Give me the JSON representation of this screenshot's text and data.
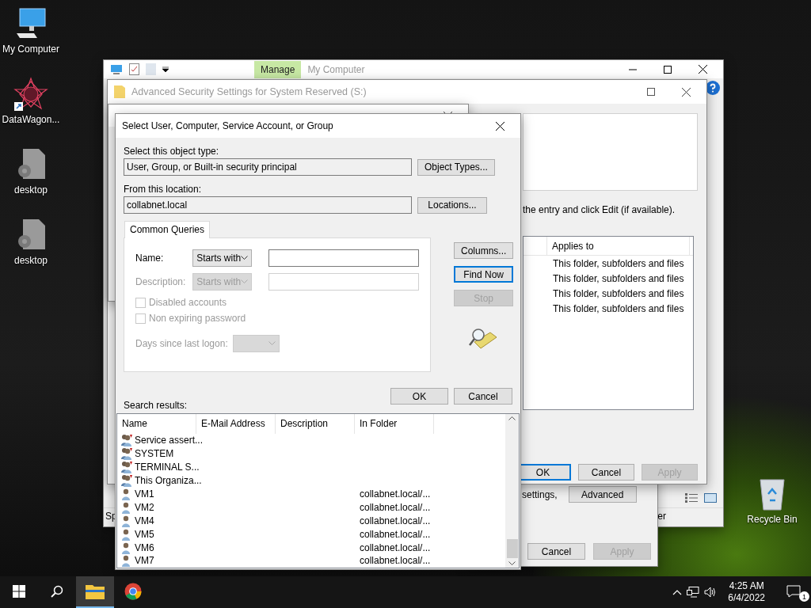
{
  "desktop_icons": [
    {
      "label": "My Computer",
      "kind": "computer"
    },
    {
      "label": "DataWagon...",
      "kind": "app"
    },
    {
      "label": "desktop",
      "kind": "file"
    },
    {
      "label": "desktop",
      "kind": "file"
    }
  ],
  "desktop_icons_right": [
    {
      "label": "Recycle Bin",
      "kind": "recycle"
    }
  ],
  "explorer_window": {
    "ribbon_tab": "Manage",
    "title": "My Computer",
    "status_left": "Sp",
    "status_right": "er"
  },
  "properties_window": {
    "text": "settings,",
    "advanced_button": "Advanced",
    "buttons": [
      {
        "label": "Cancel",
        "disabled": false
      },
      {
        "label": "Apply",
        "disabled": true
      }
    ]
  },
  "advanced_security_window": {
    "title": "Advanced Security Settings for System Reserved (S:)",
    "instruction": "the entry and click Edit (if available).",
    "table": {
      "columns": [
        "Applies to"
      ],
      "rows": [
        "This folder, subfolders and files",
        "This folder, subfolders and files",
        "This folder, subfolders and files",
        "This folder, subfolders and files"
      ]
    },
    "buttons": [
      {
        "label": "OK",
        "disabled": false,
        "default": true
      },
      {
        "label": "Cancel",
        "disabled": false,
        "default": false
      },
      {
        "label": "Apply",
        "disabled": true,
        "default": false
      }
    ]
  },
  "select_dialog": {
    "title": "Select User, Computer, Service Account, or Group",
    "object_type_label": "Select this object type:",
    "object_type_value": "User, Group, or Built-in security principal",
    "object_types_button": "Object Types...",
    "location_label": "From this location:",
    "location_value": "collabnet.local",
    "locations_button": "Locations...",
    "tabs": [
      {
        "label": "Common Queries",
        "selected": true
      }
    ],
    "name_label": "Name:",
    "name_match": "Starts with",
    "description_label": "Description:",
    "description_match": "Starts with",
    "checkboxes": [
      {
        "label": "Disabled accounts",
        "checked": false,
        "disabled": true
      },
      {
        "label": "Non expiring password",
        "checked": false,
        "disabled": true
      }
    ],
    "days_label": "Days since last logon:",
    "side_buttons": [
      {
        "label": "Columns...",
        "disabled": false,
        "default": false
      },
      {
        "label": "Find Now",
        "disabled": false,
        "default": true
      },
      {
        "label": "Stop",
        "disabled": true,
        "default": false
      }
    ],
    "ok_button": "OK",
    "cancel_button": "Cancel",
    "results_label": "Search results:",
    "results": {
      "columns": [
        "Name",
        "E-Mail Address",
        "Description",
        "In Folder"
      ],
      "rows": [
        {
          "kind": "group",
          "name": "Service assert...",
          "folder": ""
        },
        {
          "kind": "group",
          "name": "SYSTEM",
          "folder": ""
        },
        {
          "kind": "group",
          "name": "TERMINAL S...",
          "folder": ""
        },
        {
          "kind": "group",
          "name": "This Organiza...",
          "folder": ""
        },
        {
          "kind": "user",
          "name": "VM1",
          "folder": "collabnet.local/..."
        },
        {
          "kind": "user",
          "name": "VM2",
          "folder": "collabnet.local/..."
        },
        {
          "kind": "user",
          "name": "VM4",
          "folder": "collabnet.local/..."
        },
        {
          "kind": "user",
          "name": "VM5",
          "folder": "collabnet.local/..."
        },
        {
          "kind": "user",
          "name": "VM6",
          "folder": "collabnet.local/..."
        },
        {
          "kind": "user",
          "name": "VM7",
          "folder": "collabnet.local/..."
        }
      ]
    }
  },
  "taskbar": {
    "apps": [
      {
        "kind": "explorer",
        "active": true
      },
      {
        "kind": "chrome",
        "active": false
      }
    ],
    "time": "4:25 AM",
    "date": "6/4/2022",
    "notification_count": "1"
  }
}
